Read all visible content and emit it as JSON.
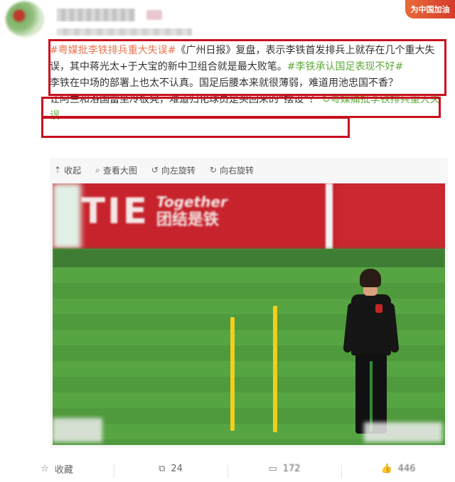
{
  "header": {
    "badge": "为中国加油"
  },
  "post": {
    "tag1": "#粤媒批李铁排兵重大失误#",
    "text1": "《广州日报》复盘，表示李铁首发排兵上就存在几个重大失误，其中蒋光太+于大宝的新中卫组合就是最大败笔。",
    "tag2": "#李铁承认国足表现不好#",
    "text2": "李铁在中场的部署上也太不认真。国足后腰本来就很薄弱，难道用池忠国不香？",
    "text3": "让阿兰和洛国富坐冷板凳，难道归化球员是买回来的“摆设”？",
    "tag3": "粤媒痛批李铁排兵重大失误"
  },
  "media_toolbar": {
    "collapse": "收起",
    "view_large": "查看大图",
    "rotate_left": "向左旋转",
    "rotate_right": "向右旋转"
  },
  "photo": {
    "banner_big": "TIE",
    "banner_small_1": "Together",
    "banner_small_2": "团结是铁"
  },
  "footer": {
    "favorite": "收藏",
    "repost_count": "24",
    "comment_count": "172",
    "like_count": "446"
  },
  "colors": {
    "highlight_box": "#c8101e",
    "tag_orange": "#eb7350",
    "tag_green": "#5faa3d"
  }
}
